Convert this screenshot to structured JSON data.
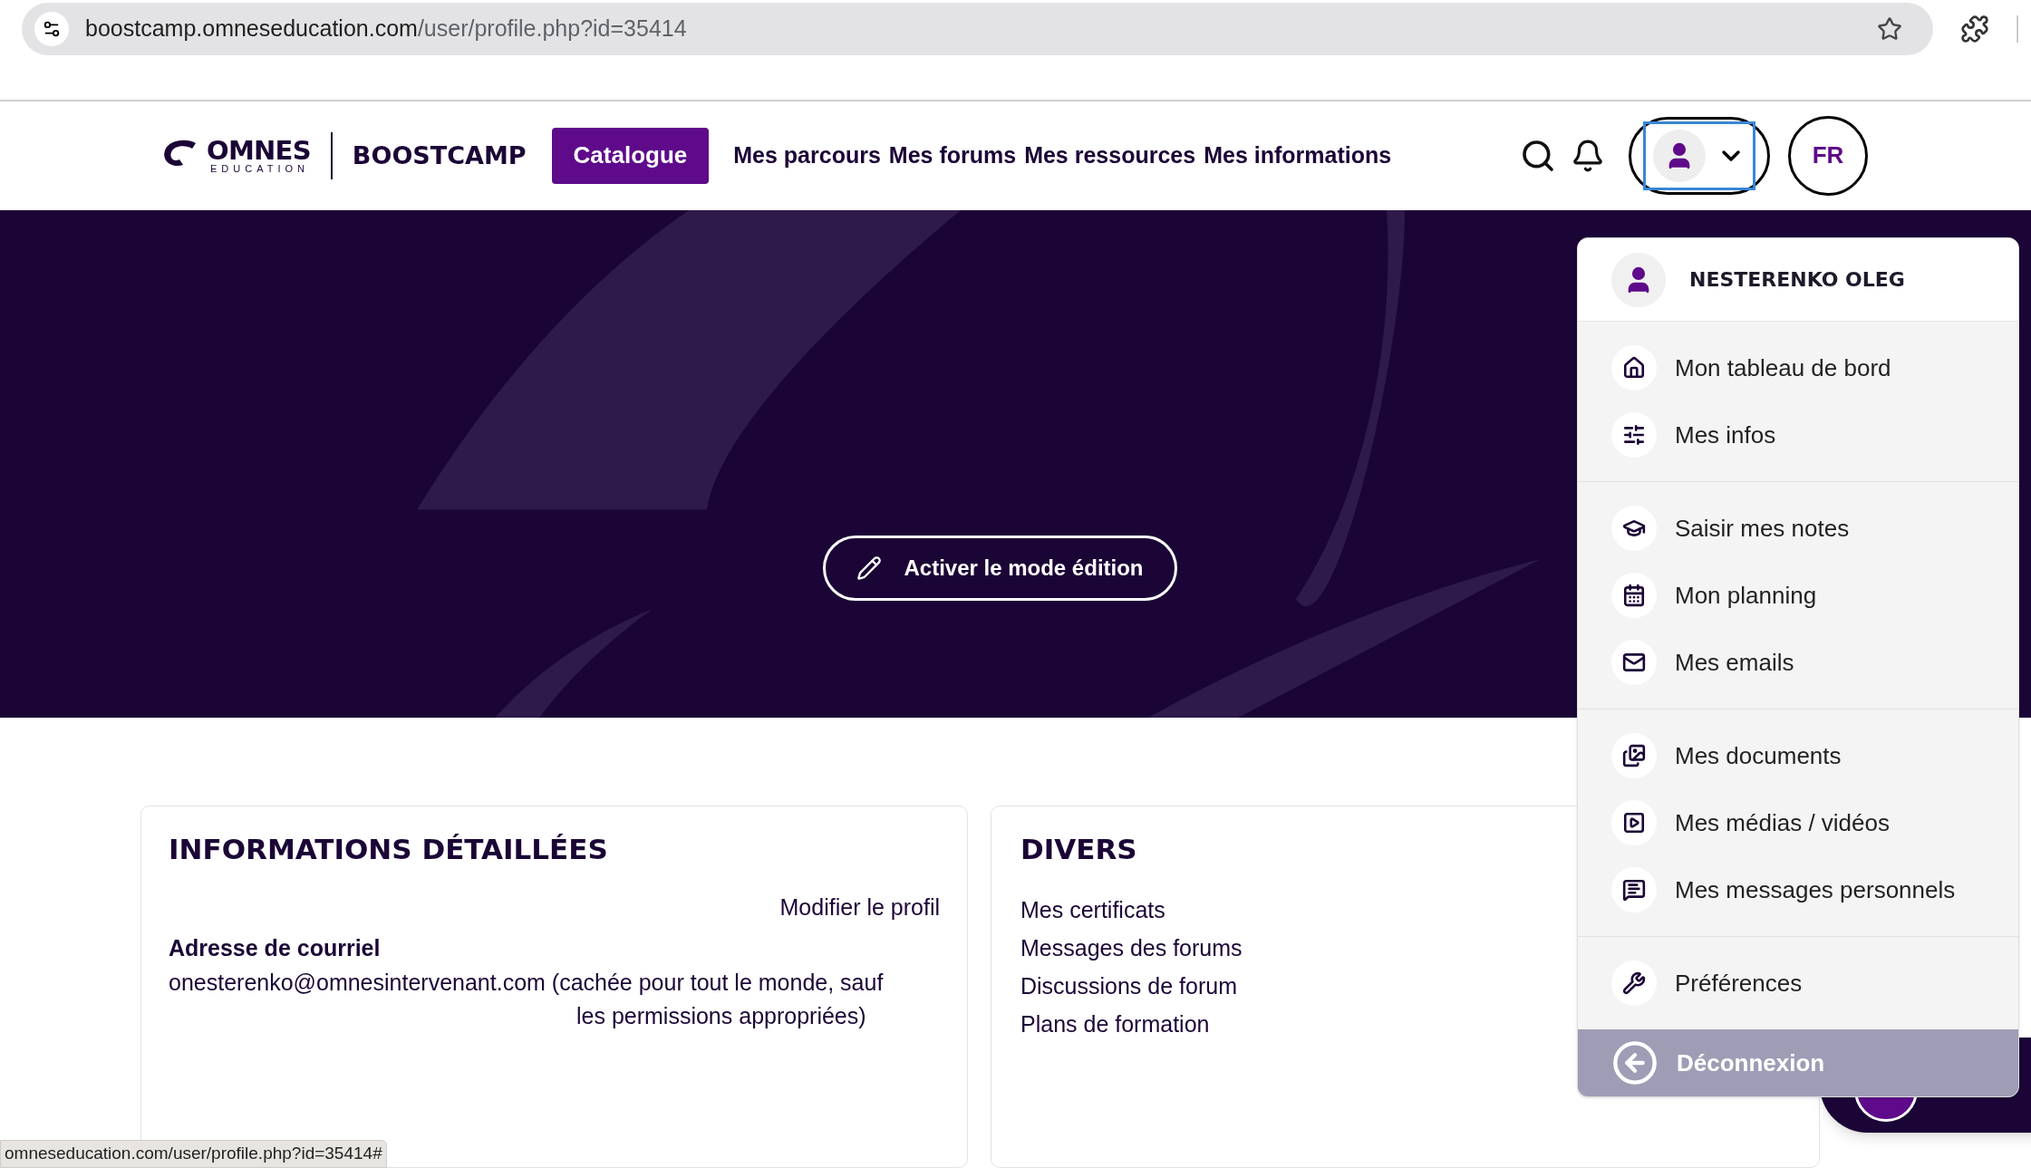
{
  "browser": {
    "url_host": "boostcamp.omneseducation.com",
    "url_path": "/user/profile.php?id=35414"
  },
  "header": {
    "logo_word": "OMNES",
    "logo_sub": "EDUCATION",
    "brand": "BOOSTCAMP",
    "nav": [
      {
        "label": "Catalogue",
        "selected": true
      },
      {
        "label": "Mes parcours",
        "selected": false
      },
      {
        "label": "Mes forums",
        "selected": false
      },
      {
        "label": "Mes ressources",
        "selected": false
      },
      {
        "label": "Mes informations",
        "selected": false
      }
    ],
    "language": "FR",
    "user_menu_expanded": true
  },
  "hero": {
    "edit_button": "Activer le mode édition"
  },
  "user_menu": {
    "user_name": "NESTERENKO OLEG",
    "groups": [
      [
        "Mon tableau de bord",
        "Mes infos"
      ],
      [
        "Saisir mes notes",
        "Mon planning",
        "Mes emails"
      ],
      [
        "Mes documents",
        "Mes médias / vidéos",
        "Mes messages personnels"
      ],
      [
        "Préférences"
      ]
    ],
    "logout": "Déconnexion"
  },
  "details_card": {
    "title": "INFORMATIONS DÉTAILLÉES",
    "edit_link": "Modifier le profil",
    "email_label": "Adresse de courriel",
    "email_line_1": "onesterenko@omnesintervenant.com (cachée pour tout le monde, sauf",
    "email_line_2": "les permissions appropriées)"
  },
  "misc_card": {
    "title": "DIVERS",
    "links": [
      "Mes certificats",
      "Messages des forums",
      "Discussions de forum",
      "Plans de formation"
    ]
  },
  "status_bar": "omneseducation.com/user/profile.php?id=35414#"
}
